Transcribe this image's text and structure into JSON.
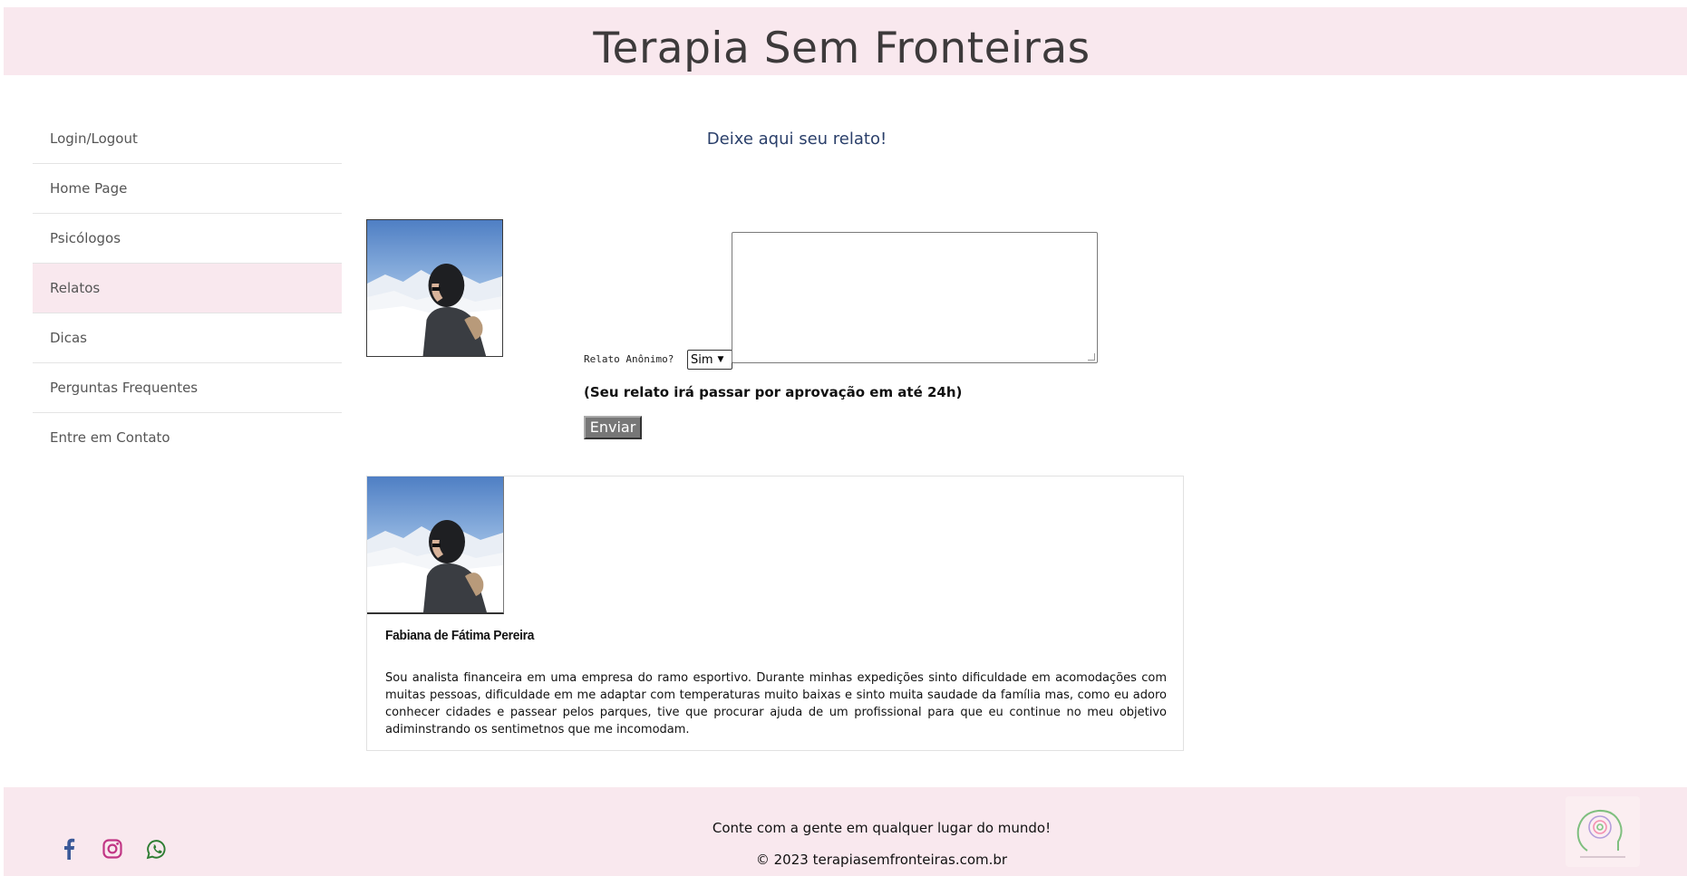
{
  "header": {
    "title": "Terapia Sem Fronteiras"
  },
  "sidebar": {
    "items": [
      {
        "label": "Login/Logout"
      },
      {
        "label": "Home Page"
      },
      {
        "label": "Psicólogos"
      },
      {
        "label": "Relatos",
        "active": true
      },
      {
        "label": "Dicas"
      },
      {
        "label": "Perguntas Frequentes"
      },
      {
        "label": "Entre em Contato"
      }
    ]
  },
  "form": {
    "title": "Deixe aqui seu relato!",
    "anon_label": "Relato Anônimo?",
    "anon_value": "Sim",
    "relato_value": "",
    "approval_note": "(Seu relato irá passar por aprovação em até 24h)",
    "submit_label": "Enviar"
  },
  "testimonial": {
    "name": "Fabiana de Fátima Pereira",
    "text": "Sou analista financeira em uma empresa do ramo esportivo. Durante minhas expedições sinto dificuldade em acomodações com muitas pessoas, dificuldade em me adaptar com temperaturas muito baixas e sinto muita saudade da família mas, como eu adoro conhecer cidades e passear pelos parques, tive que procurar ajuda de um profissional para que eu continue no meu objetivo adiminstrando os sentimetnos que me incomodam."
  },
  "footer": {
    "tagline": "Conte com a gente em qualquer lugar do mundo!",
    "copyright": "© 2023 terapiasemfronteiras.com.br",
    "socials": [
      "facebook-icon",
      "instagram-icon",
      "whatsapp-icon"
    ]
  },
  "colors": {
    "accent_pink": "#f9e8ee",
    "title_blue": "#2a3f6a",
    "facebook": "#3b5998",
    "instagram": "#c13584",
    "whatsapp": "#2e7d32"
  }
}
